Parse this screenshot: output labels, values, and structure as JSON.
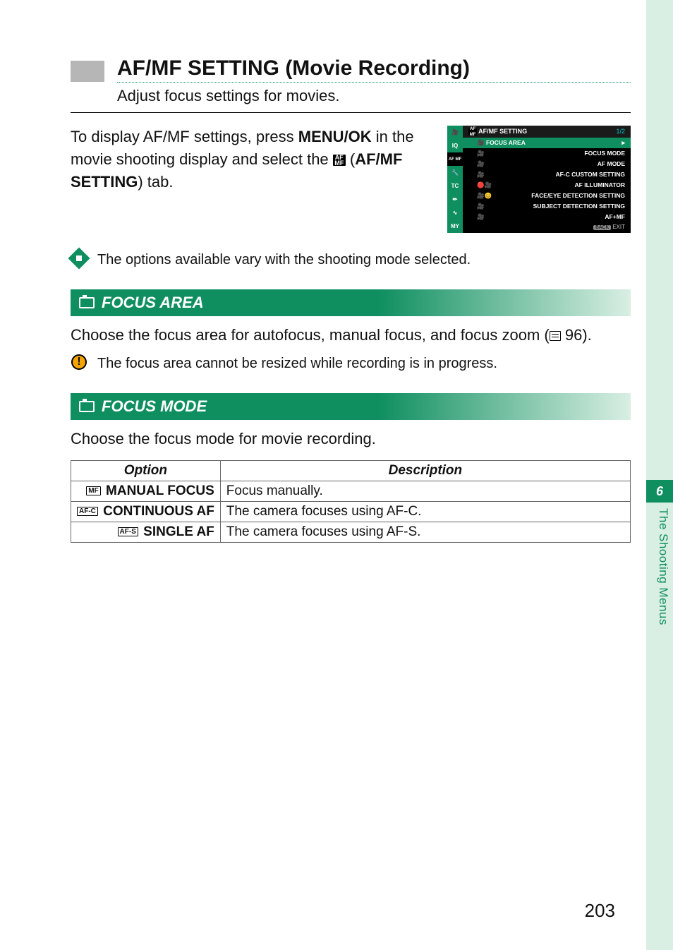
{
  "page_number": "203",
  "chapter": {
    "number": "6",
    "label": "The Shooting Menus"
  },
  "title": "AF/MF SETTING (Movie Recording)",
  "subtitle": "Adjust focus settings for movies.",
  "intro": {
    "part1": "To display AF/MF settings, press ",
    "menu_ok": "MENU/OK",
    "part2": " in the movie shooting display and select the ",
    "tab_badge": "AF MF",
    "tab_name": "AF/MF SETTING",
    "part3": ") tab."
  },
  "camera_menu": {
    "header": "AF/MF SETTING",
    "page_indicator": "1/2",
    "tabs": [
      "🎥",
      "IQ",
      "AF MF",
      "🔧",
      "TC",
      "✏",
      "∿",
      "MY"
    ],
    "items": [
      "FOCUS AREA",
      "FOCUS MODE",
      "AF MODE",
      "AF-C CUSTOM SETTING",
      "AF ILLUMINATOR",
      "FACE/EYE DETECTION SETTING",
      "SUBJECT DETECTION SETTING",
      "AF+MF"
    ],
    "footer_back": "BACK",
    "footer_exit": "EXIT"
  },
  "note_diamond": "The options available vary with the shooting mode selected.",
  "section_focus_area": {
    "title": "FOCUS AREA",
    "body_1": "Choose the focus area for autofocus, manual focus, and focus zoom (",
    "page_ref": "96",
    "body_2": ").",
    "caution": "The focus area cannot be resized while recording is in progress."
  },
  "section_focus_mode": {
    "title": "FOCUS MODE",
    "body": "Choose the focus mode for movie recording.",
    "table": {
      "header_option": "Option",
      "header_description": "Description",
      "rows": [
        {
          "badge": "MF",
          "label": "MANUAL FOCUS",
          "desc": "Focus manually."
        },
        {
          "badge": "AF-C",
          "label": "CONTINUOUS AF",
          "desc": "The camera focuses using AF-C."
        },
        {
          "badge": "AF-S",
          "label": "SINGLE AF",
          "desc": "The camera focuses using AF-S."
        }
      ]
    }
  }
}
